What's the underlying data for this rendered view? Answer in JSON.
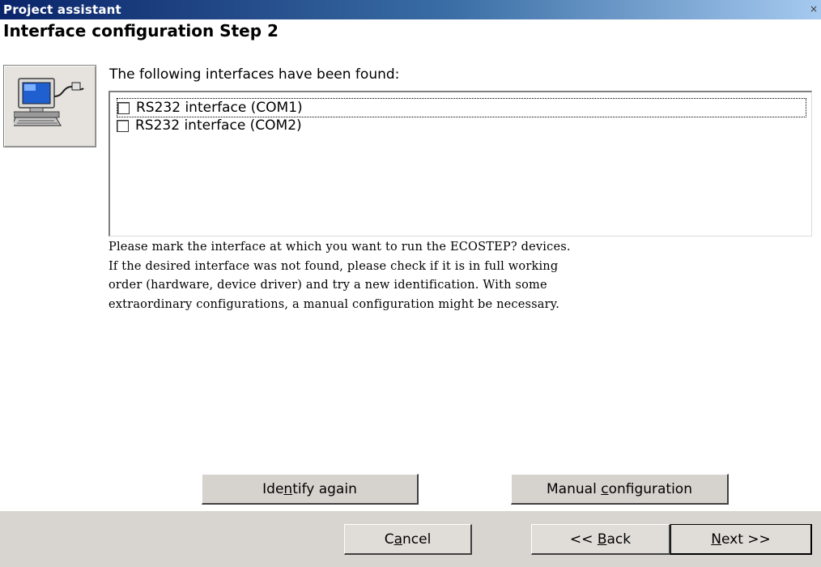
{
  "window": {
    "title": "Project assistant",
    "close_glyph": "×"
  },
  "page": {
    "heading": "Interface configuration Step 2"
  },
  "icon": {
    "name": "computer-connection-icon"
  },
  "intro_text": "The following interfaces have been found:",
  "interfaces": [
    {
      "label": "RS232 interface (COM1)",
      "checked": false,
      "focused": true
    },
    {
      "label": "RS232 interface (COM2)",
      "checked": false,
      "focused": false
    }
  ],
  "info_lines": [
    "Please mark the interface at which you want to run the ECOSTEP? devices.",
    "If the desired interface was not found, please check if it is in full working",
    "order (hardware, device driver) and try a new identification. With some",
    "extraordinary configurations, a manual configuration might be necessary."
  ],
  "buttons": {
    "identify_again": {
      "label": "Identify again",
      "mnemonic": "n"
    },
    "manual_configuration": {
      "label": "Manual configuration",
      "mnemonic": "c"
    },
    "cancel": {
      "label": "Cancel",
      "mnemonic": "a"
    },
    "back": {
      "label": "<< Back",
      "mnemonic": "B"
    },
    "next": {
      "label": "Next >>",
      "mnemonic": "N"
    }
  }
}
